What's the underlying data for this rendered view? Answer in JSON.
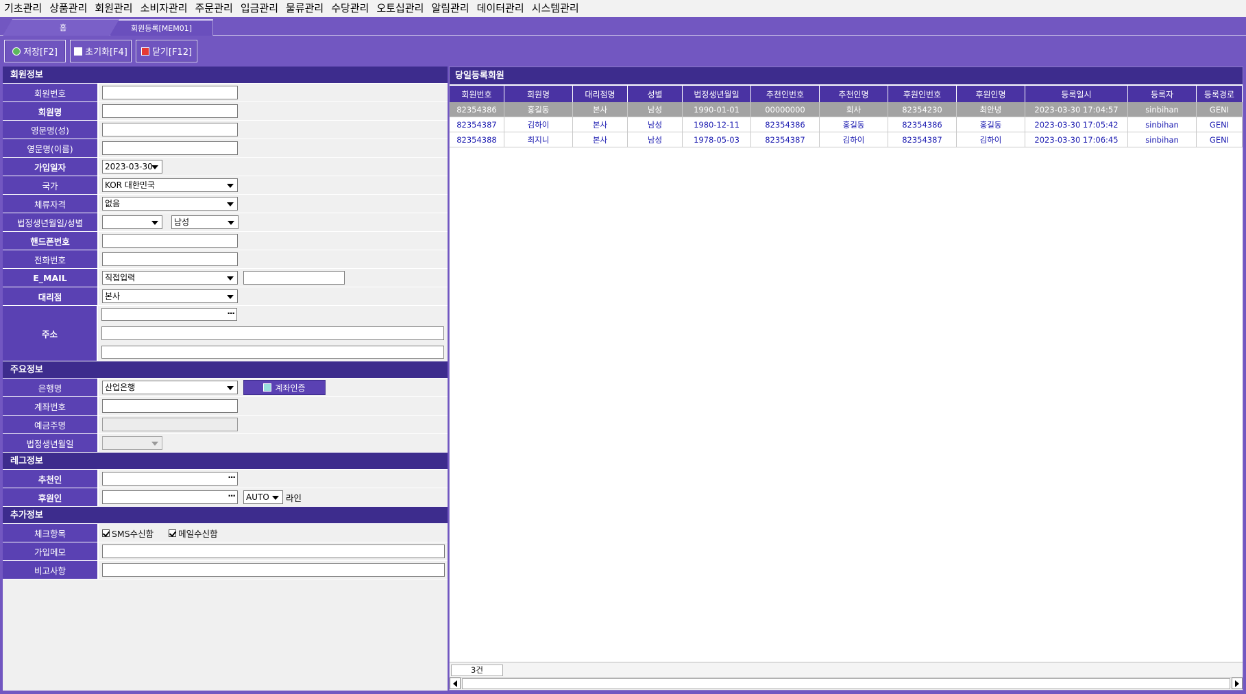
{
  "menu": [
    "기초관리",
    "상품관리",
    "회원관리",
    "소비자관리",
    "주문관리",
    "입금관리",
    "물류관리",
    "수당관리",
    "오토십관리",
    "알림관리",
    "데이터관리",
    "시스템관리"
  ],
  "tabs": {
    "home": "홈",
    "member": "회원등록[MEM01]"
  },
  "toolbar": {
    "save": "저장[F2]",
    "reset": "초기화[F4]",
    "close": "닫기[F12]"
  },
  "form": {
    "sections": {
      "member_info": "회원정보",
      "main_info": "주요정보",
      "leg_info": "레그정보",
      "extra_info": "추가정보"
    },
    "labels": {
      "member_no": "회원번호",
      "member_name": "회원명",
      "eng_last": "영문명(성)",
      "eng_first": "영문명(이름)",
      "join_date": "가입일자",
      "country": "국가",
      "stay_status": "체류자격",
      "birth_gender": "법정생년월일/성별",
      "mobile": "핸드폰번호",
      "phone": "전화번호",
      "email": "E_MAIL",
      "branch": "대리점",
      "address": "주소",
      "bank": "은행명",
      "account_no": "계좌번호",
      "account_holder": "예금주명",
      "birth": "법정생년월일",
      "recommender": "추천인",
      "sponsor": "후원인",
      "check_items": "체크항목",
      "join_memo": "가입메모",
      "remarks": "비고사항"
    },
    "values": {
      "join_date": "2023-03-30",
      "country": "KOR 대한민국",
      "stay_status": "없음",
      "gender": "남성",
      "email_domain": "직접입력",
      "branch": "본사",
      "bank": "산업은행",
      "sponsor_line": "AUTO",
      "line_label": "라인"
    },
    "verify_account": "계좌인증",
    "checks": {
      "sms": "SMS수신함",
      "mail": "메일수신함"
    }
  },
  "grid": {
    "title": "당일등록회원",
    "columns": [
      "회원번호",
      "회원명",
      "대리점명",
      "성별",
      "법정생년월일",
      "추천인번호",
      "추천인명",
      "후원인번호",
      "후원인명",
      "등록일시",
      "등록자",
      "등록경로"
    ],
    "rows": [
      [
        "82354386",
        "홍길동",
        "본사",
        "남성",
        "1990-01-01",
        "00000000",
        "회사",
        "82354230",
        "최안녕",
        "2023-03-30 17:04:57",
        "sinbihan",
        "GENI"
      ],
      [
        "82354387",
        "김하이",
        "본사",
        "남성",
        "1980-12-11",
        "82354386",
        "홍길동",
        "82354386",
        "홍길동",
        "2023-03-30 17:05:42",
        "sinbihan",
        "GENI"
      ],
      [
        "82354388",
        "최지니",
        "본사",
        "남성",
        "1978-05-03",
        "82354387",
        "김하이",
        "82354387",
        "김하이",
        "2023-03-30 17:06:45",
        "sinbihan",
        "GENI"
      ]
    ],
    "count": "3건"
  }
}
